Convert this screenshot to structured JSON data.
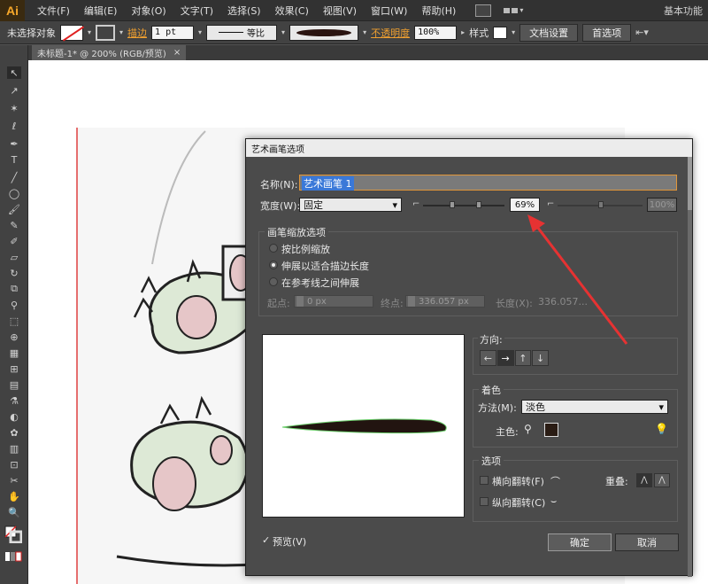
{
  "app": {
    "logo": "Ai",
    "workspace": "基本功能"
  },
  "menubar": {
    "items": [
      "文件(F)",
      "编辑(E)",
      "对象(O)",
      "文字(T)",
      "选择(S)",
      "效果(C)",
      "视图(V)",
      "窗口(W)",
      "帮助(H)"
    ]
  },
  "controlbar": {
    "selection_label": "未选择对象",
    "stroke_label": "描边",
    "stroke_weight": "1 pt",
    "profile_label": "等比",
    "opacity_label": "不透明度",
    "opacity_value": "100%",
    "style_label": "样式",
    "doc_setup": "文档设置",
    "preferences": "首选项"
  },
  "document": {
    "tab_title": "未标题-1* @ 200% (RGB/预览)",
    "close": "×"
  },
  "dialog": {
    "title": "艺术画笔选项",
    "name_label": "名称(N):",
    "name_value": "艺术画笔 1",
    "width_label": "宽度(W):",
    "width_mode": "固定",
    "width_percent": "69%",
    "width_max": "100%",
    "scale_group_title": "画笔缩放选项",
    "scale_options": [
      "按比例缩放",
      "伸展以适合描边长度",
      "在参考线之间伸展"
    ],
    "scale_selected": 1,
    "start_label": "起点:",
    "start_value": "0 px",
    "end_label": "终点:",
    "end_value": "336.057 px",
    "length_label": "长度(X):",
    "length_value": "336.057...",
    "direction_title": "方向:",
    "direction_buttons": [
      "←",
      "→",
      "↑",
      "↓"
    ],
    "direction_selected": 1,
    "colorize_title": "着色",
    "method_label": "方法(M):",
    "method_value": "淡色",
    "key_color_label": "主色:",
    "key_color": "#2a1c14",
    "options_title": "选项",
    "flip_along_label": "横向翻转(F)",
    "flip_across_label": "纵向翻转(C)",
    "overlap_label": "重叠:",
    "preview_label": "预览(V)",
    "preview_checked": "✓",
    "ok": "确定",
    "cancel": "取消"
  }
}
